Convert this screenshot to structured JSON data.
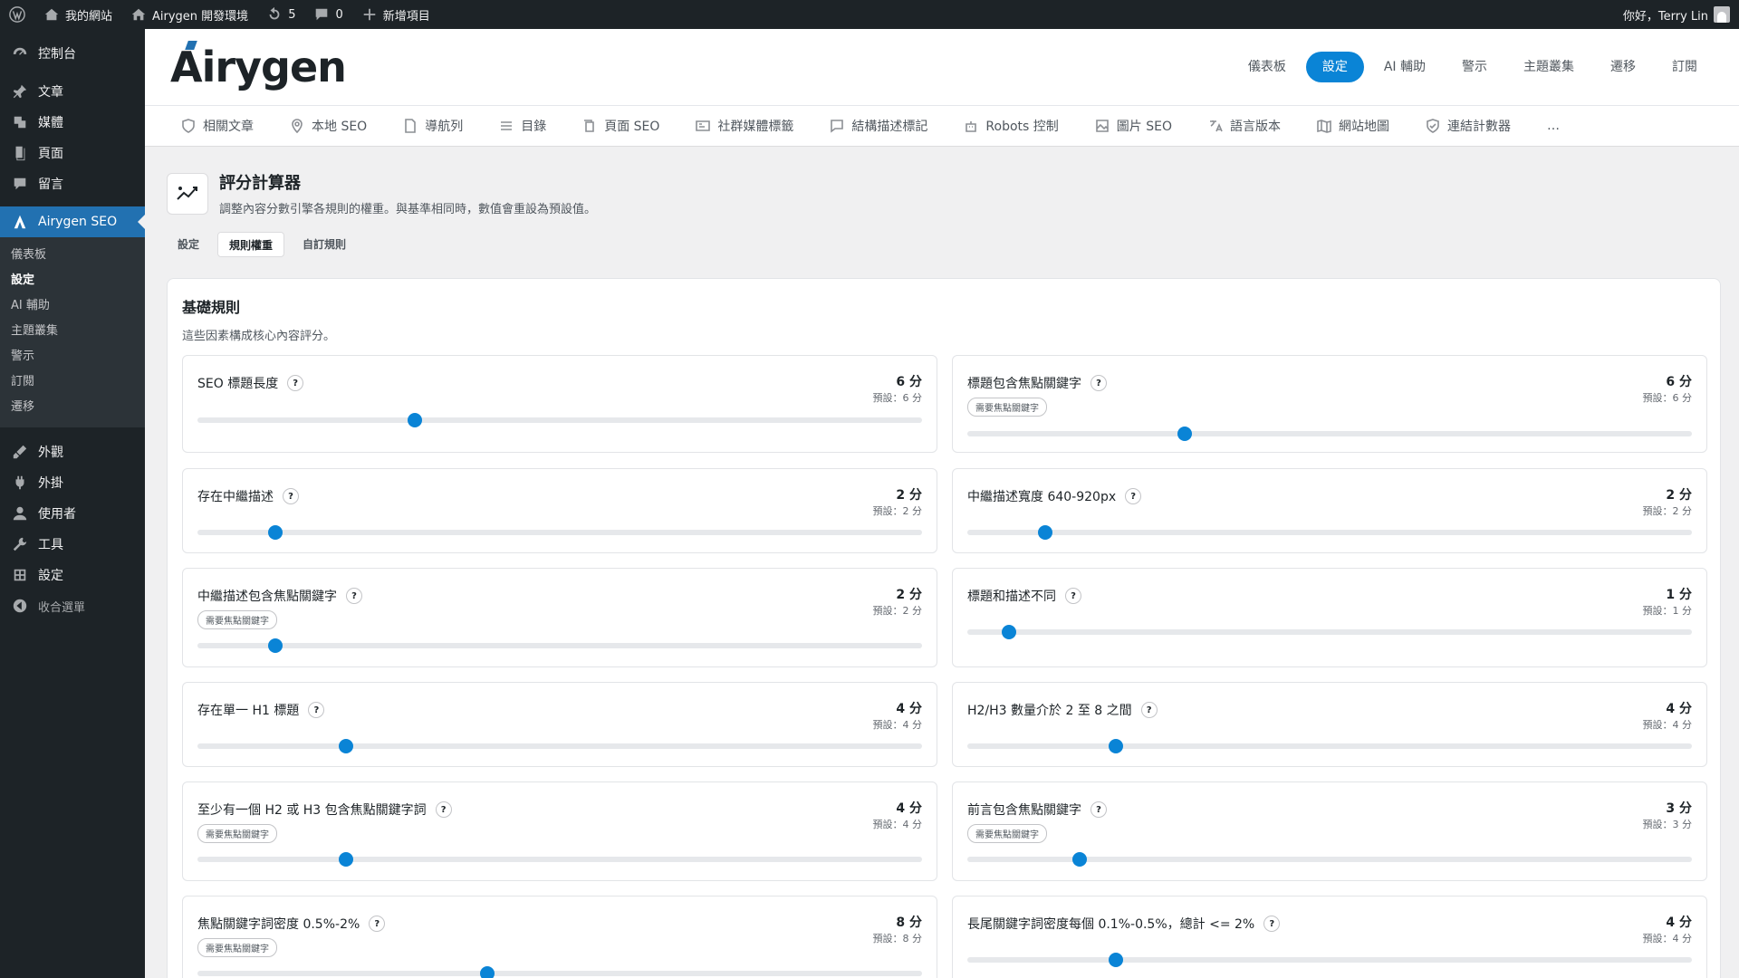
{
  "adminbar": {
    "site_name": "我的網站",
    "env_name": "Airygen 開發環境",
    "updates_count": "5",
    "comments_count": "0",
    "new_item": "新增項目",
    "greeting": "你好，Terry Lin"
  },
  "sidebar": {
    "items": [
      {
        "label": "控制台",
        "icon": "dashboard-icon"
      },
      {
        "label": "文章",
        "icon": "pin-icon"
      },
      {
        "label": "媒體",
        "icon": "media-icon"
      },
      {
        "label": "頁面",
        "icon": "page-icon"
      },
      {
        "label": "留言",
        "icon": "comment-icon"
      },
      {
        "label": "Airygen SEO",
        "icon": "airygen-icon"
      },
      {
        "label": "外觀",
        "icon": "brush-icon"
      },
      {
        "label": "外掛",
        "icon": "plugin-icon"
      },
      {
        "label": "使用者",
        "icon": "user-icon"
      },
      {
        "label": "工具",
        "icon": "wrench-icon"
      },
      {
        "label": "設定",
        "icon": "settings-icon"
      },
      {
        "label": "收合選單",
        "icon": "collapse-icon"
      }
    ],
    "submenu": [
      "儀表板",
      "設定",
      "AI 輔助",
      "主題叢集",
      "警示",
      "訂閱",
      "遷移"
    ]
  },
  "header": {
    "logo": "Airygen",
    "nav": [
      "儀表板",
      "設定",
      "AI 輔助",
      "警示",
      "主題叢集",
      "遷移",
      "訂閱"
    ],
    "active_nav": "設定"
  },
  "subnav": [
    "相關文章",
    "本地 SEO",
    "導航列",
    "目錄",
    "頁面 SEO",
    "社群媒體標籤",
    "結構描述標記",
    "Robots 控制",
    "圖片 SEO",
    "語言版本",
    "網站地圖",
    "連結計數器",
    "…"
  ],
  "page": {
    "title": "評分計算器",
    "description": "調整內容分數引擎各規則的權重。與基準相同時，數值會重設為預設值。",
    "tabs": [
      "設定",
      "規則權重",
      "自訂規則"
    ],
    "active_tab": "規則權重"
  },
  "section": {
    "title": "基礎規則",
    "description": "這些因素構成核心內容評分。",
    "badge_label": "需要焦點關鍵字",
    "rules": [
      {
        "title": "SEO 標題長度",
        "score": "6 分",
        "default": "預設：6 分",
        "badge": false,
        "value_fraction": 0.3
      },
      {
        "title": "標題包含焦點關鍵字",
        "score": "6 分",
        "default": "預設：6 分",
        "badge": true,
        "value_fraction": 0.3
      },
      {
        "title": "存在中繼描述",
        "score": "2 分",
        "default": "預設：2 分",
        "badge": false,
        "value_fraction": 0.107
      },
      {
        "title": "中繼描述寬度 640-920px",
        "score": "2 分",
        "default": "預設：2 分",
        "badge": false,
        "value_fraction": 0.107
      },
      {
        "title": "中繼描述包含焦點關鍵字",
        "score": "2 分",
        "default": "預設：2 分",
        "badge": true,
        "value_fraction": 0.107
      },
      {
        "title": "標題和描述不同",
        "score": "1 分",
        "default": "預設：1 分",
        "badge": false,
        "value_fraction": 0.058
      },
      {
        "title": "存在單一 H1 標題",
        "score": "4 分",
        "default": "預設：4 分",
        "badge": false,
        "value_fraction": 0.205
      },
      {
        "title": "H2/H3 數量介於 2 至 8 之間",
        "score": "4 分",
        "default": "預設：4 分",
        "badge": false,
        "value_fraction": 0.205
      },
      {
        "title": "至少有一個 H2 或 H3 包含焦點關鍵字詞",
        "score": "4 分",
        "default": "預設：4 分",
        "badge": true,
        "value_fraction": 0.205
      },
      {
        "title": "前言包含焦點關鍵字",
        "score": "3 分",
        "default": "預設：3 分",
        "badge": true,
        "value_fraction": 0.155
      },
      {
        "title": "焦點關鍵字詞密度 0.5%-2%",
        "score": "8 分",
        "default": "預設：8 分",
        "badge": true,
        "value_fraction": 0.4
      },
      {
        "title": "長尾關鍵字詞密度每個 0.1%-0.5%，總計 <= 2%",
        "score": "4 分",
        "default": "預設：4 分",
        "badge": false,
        "value_fraction": 0.205
      }
    ]
  }
}
